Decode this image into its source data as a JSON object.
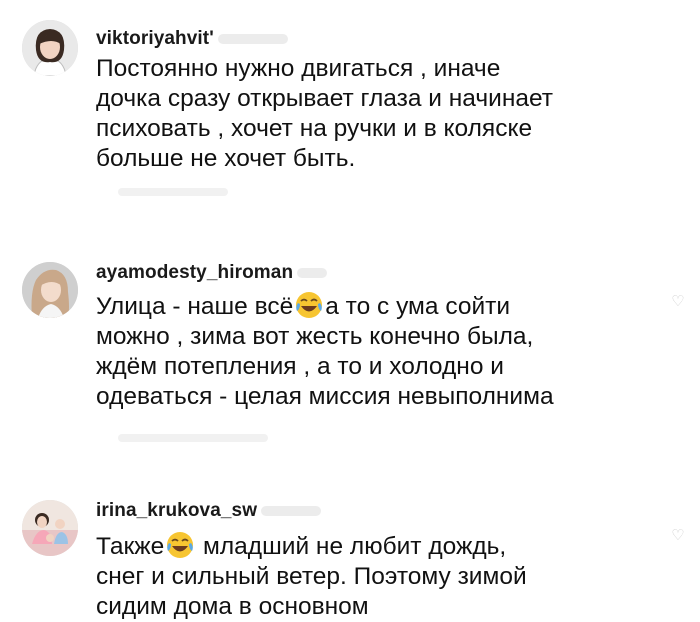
{
  "comments": [
    {
      "username": "viktoriyahvit'",
      "text": "Постоянно нужно двигаться , иначе\nдочка сразу открывает глаза и начинает\nпсиховать , хочет на ручки и в коляске\nбольше не хочет быть.",
      "avatar_icon": "avatar-woman-dark-hair"
    },
    {
      "username": "ayamodesty_hiroman",
      "text_before": "Улица - наше всё",
      "emoji": "face-with-tears-of-joy",
      "text_after": "а то с ума сойти\nможно , зима вот жесть конечно была,\nждём потепления , а то и холодно и\nодеваться - целая миссия невыполнима",
      "avatar_icon": "avatar-woman-long-hair"
    },
    {
      "username": "irina_krukova_sw",
      "text_before": "Также",
      "emoji": "face-with-tears-of-joy",
      "text_after": "  младший не любит дождь,\nснег и сильный ветер. Поэтому зимой\nсидим дома в основном",
      "avatar_icon": "avatar-family-photo"
    }
  ],
  "colors": {
    "text": "#111111",
    "username": "#1a1a1a",
    "emoji_face": "#f7c531"
  }
}
